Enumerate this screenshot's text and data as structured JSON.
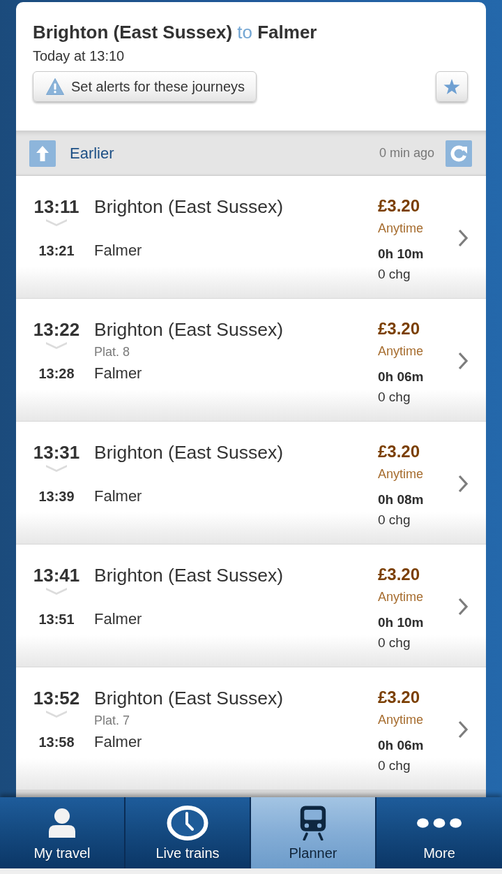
{
  "header": {
    "title": "**Brighton (East Sussex)** to **Falmer**",
    "date": "Today at 13:10",
    "alert_button": "Set alerts for these journeys"
  },
  "earlier_bar": {
    "label": "Earlier",
    "updated": "0 min ago"
  },
  "journeys": [
    {
      "depart": "13:11",
      "from": "Brighton (East Sussex)",
      "arrive": "13:21",
      "to": "Falmer",
      "price": "£3.20",
      "fare": "Anytime",
      "duration": "0h 10m",
      "changes": "0 chg"
    },
    {
      "depart": "13:22",
      "from": "Brighton (East Sussex)",
      "platform": "Plat. 8",
      "arrive": "13:28",
      "to": "Falmer",
      "price": "£3.20",
      "fare": "Anytime",
      "duration": "0h 06m",
      "changes": "0 chg"
    },
    {
      "depart": "13:31",
      "from": "Brighton (East Sussex)",
      "arrive": "13:39",
      "to": "Falmer",
      "price": "£3.20",
      "fare": "Anytime",
      "duration": "0h 08m",
      "changes": "0 chg"
    },
    {
      "depart": "13:41",
      "from": "Brighton (East Sussex)",
      "arrive": "13:51",
      "to": "Falmer",
      "price": "£3.20",
      "fare": "Anytime",
      "duration": "0h 10m",
      "changes": "0 chg"
    },
    {
      "depart": "13:52",
      "from": "Brighton (East Sussex)",
      "platform": "Plat. 7",
      "arrive": "13:58",
      "to": "Falmer",
      "price": "£3.20",
      "fare": "Anytime",
      "duration": "0h 06m",
      "changes": "0 chg"
    }
  ],
  "tabs": [
    {
      "label": "My travel",
      "selected": false
    },
    {
      "label": "Live trains",
      "selected": false
    },
    {
      "label": "Planner",
      "selected": true
    },
    {
      "label": "More",
      "selected": false
    }
  ]
}
